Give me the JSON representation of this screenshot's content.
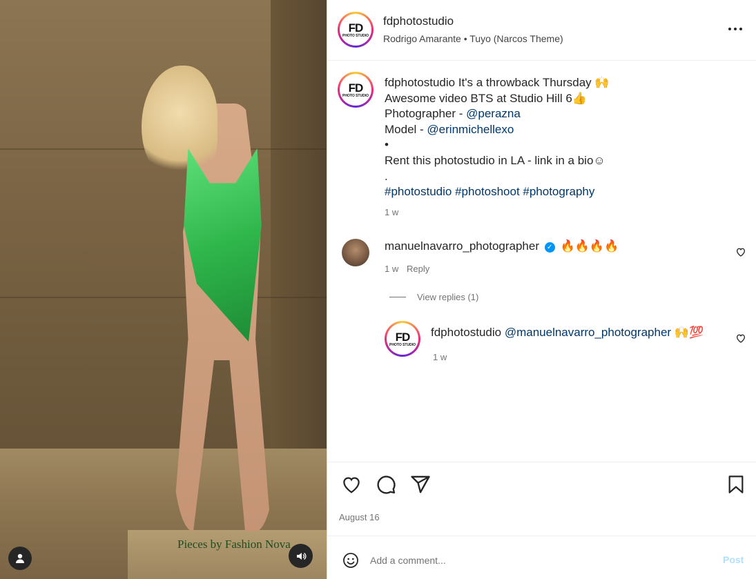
{
  "media": {
    "watermark": "Pieces by Fashion Nova"
  },
  "header": {
    "logo_text": "FD",
    "logo_subtext": "PHOTO STUDIO",
    "username": "fdphotostudio",
    "audio": "Rodrigo Amarante • Tuyo (Narcos Theme)"
  },
  "caption": {
    "username": "fdphotostudio",
    "line1": "It's a throwback Thursday 🙌",
    "line2": "Awesome video BTS at Studio Hill 6👍",
    "photographer_label": "Photographer - ",
    "photographer_link": "@perazna",
    "model_label": "Model - ",
    "model_link": "@erinmichellexo",
    "bullet": "•",
    "rent": "Rent this photostudio in LA - link in a bio☺",
    "dot": ".",
    "hashtags": "#photostudio #photoshoot #photography",
    "time": "1 w"
  },
  "comment": {
    "username": "manuelnavarro_photographer",
    "verified_glyph": "✓",
    "text": "🔥🔥🔥🔥",
    "time": "1 w",
    "reply_label": "Reply",
    "view_replies": "View replies (1)"
  },
  "reply": {
    "username": "fdphotostudio",
    "mention": "@manuelnavarro_photographer",
    "text": "🙌💯",
    "time": "1 w"
  },
  "actions": {
    "date": "August 16"
  },
  "add_comment": {
    "placeholder": "Add a comment...",
    "post_label": "Post"
  },
  "colors": {
    "link": "#00376b",
    "verified": "#0095f6",
    "post_disabled": "#b2dffc"
  },
  "icons": [
    "user-icon",
    "speaker-icon",
    "more-icon",
    "heart-icon",
    "comment-icon",
    "share-icon",
    "bookmark-icon",
    "emoji-icon"
  ]
}
